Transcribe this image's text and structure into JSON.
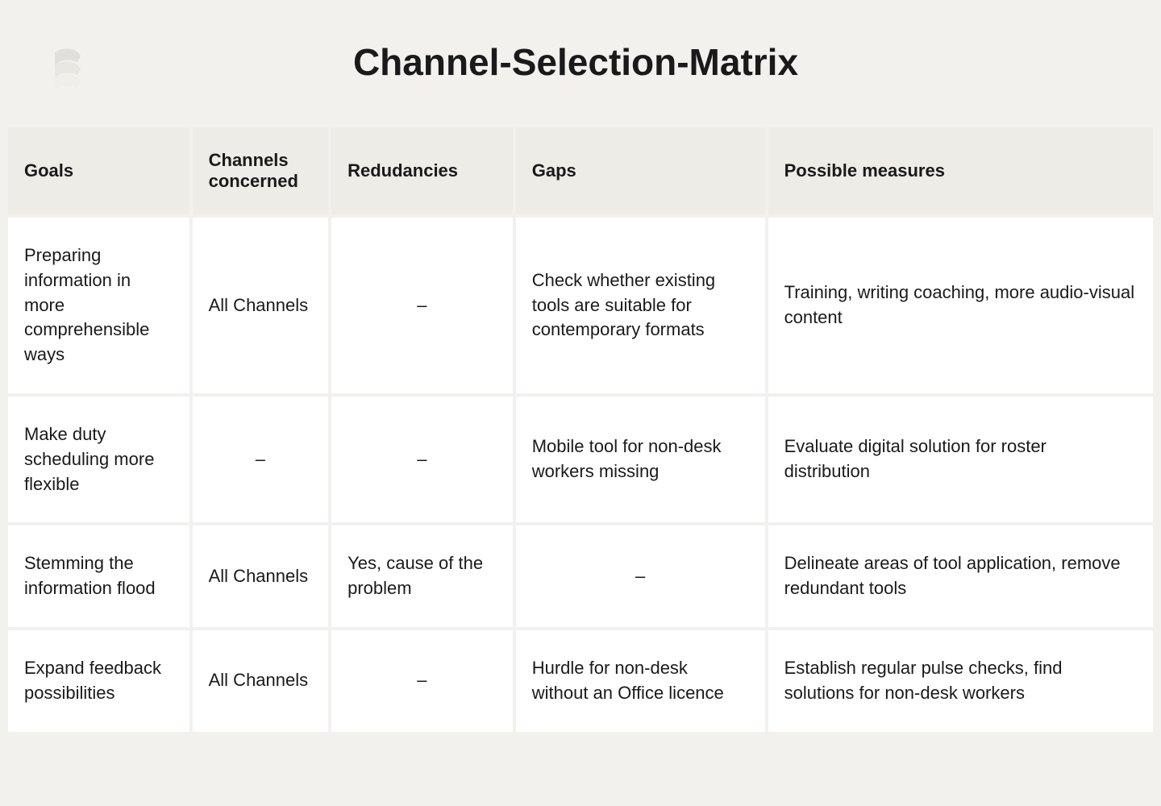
{
  "title": "Channel-Selection-Matrix",
  "chart_data": {
    "type": "table",
    "headers": [
      "Goals",
      "Channels concerned",
      "Redudancies",
      "Gaps",
      "Possible measures"
    ],
    "rows": [
      {
        "goals": "Preparing information in more comprehensible ways",
        "channels": "All Channels",
        "redundancies": "–",
        "gaps": "Check whether existing tools are suitable for contemporary formats",
        "measures": "Training, writing coaching, more audio-visual content"
      },
      {
        "goals": "Make duty scheduling more flexible",
        "channels": "–",
        "redundancies": "–",
        "gaps": "Mobile tool for non-desk workers missing",
        "measures": "Evaluate digital solution for roster distribution"
      },
      {
        "goals": "Stemming the information flood",
        "channels": "All Channels",
        "redundancies": "Yes, cause of the problem",
        "gaps": "–",
        "measures": "Delineate areas of tool application, remove redundant tools"
      },
      {
        "goals": "Expand feedback possibilities",
        "channels": "All Channels",
        "redundancies": "–",
        "gaps": "Hurdle for non-desk without an Office licence",
        "measures": "Establish regular pulse checks, find solutions for non-desk workers"
      }
    ]
  }
}
